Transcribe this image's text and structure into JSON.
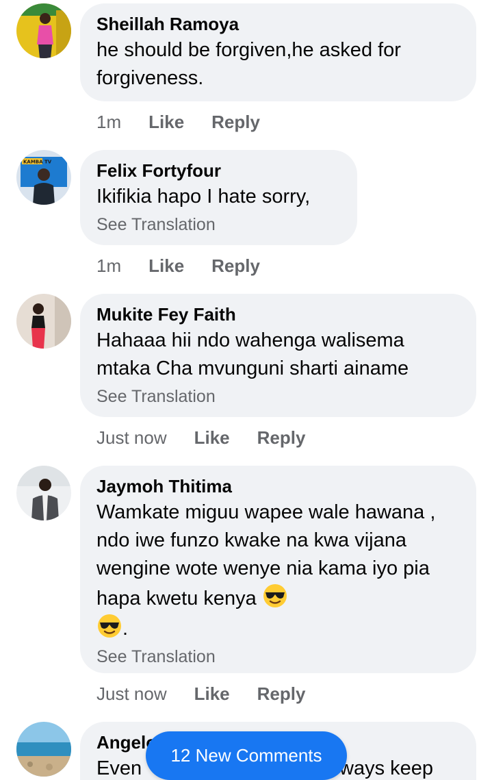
{
  "colors": {
    "bubble_bg": "#f0f2f5",
    "meta_text": "#65676b",
    "accent": "#1877f2"
  },
  "comments": [
    {
      "author": "Sheillah Ramoya",
      "text": "he should be forgiven,he asked for forgiveness.",
      "see_translation": "",
      "time": "1m",
      "like_label": "Like",
      "reply_label": "Reply"
    },
    {
      "author": "Felix Fortyfour",
      "text": "Ikifikia hapo I hate sorry,",
      "see_translation": "See Translation",
      "time": "1m",
      "like_label": "Like",
      "reply_label": "Reply",
      "avatar_caption": "KAMBA TV"
    },
    {
      "author": "Mukite Fey Faith",
      "text": "Hahaaa hii ndo wahenga walisema mtaka Cha mvunguni sharti ainame",
      "see_translation": "See Translation",
      "time": "Just now",
      "like_label": "Like",
      "reply_label": "Reply"
    },
    {
      "author": "Jaymoh Thitima",
      "text": "Wamkate miguu wapee wale hawana , ndo iwe funzo kwake na kwa vijana wengine wote wenye nia kama iyo pia hapa kwetu kenya",
      "text_tail": ".",
      "emoji": "smiling-face-with-sunglasses",
      "see_translation": "See Translation",
      "time": "Just now",
      "like_label": "Like",
      "reply_label": "Reply"
    },
    {
      "author": "Angelo",
      "text": "Even",
      "text_tail": "ways keep"
    }
  ],
  "new_comments_label": "12 New Comments"
}
